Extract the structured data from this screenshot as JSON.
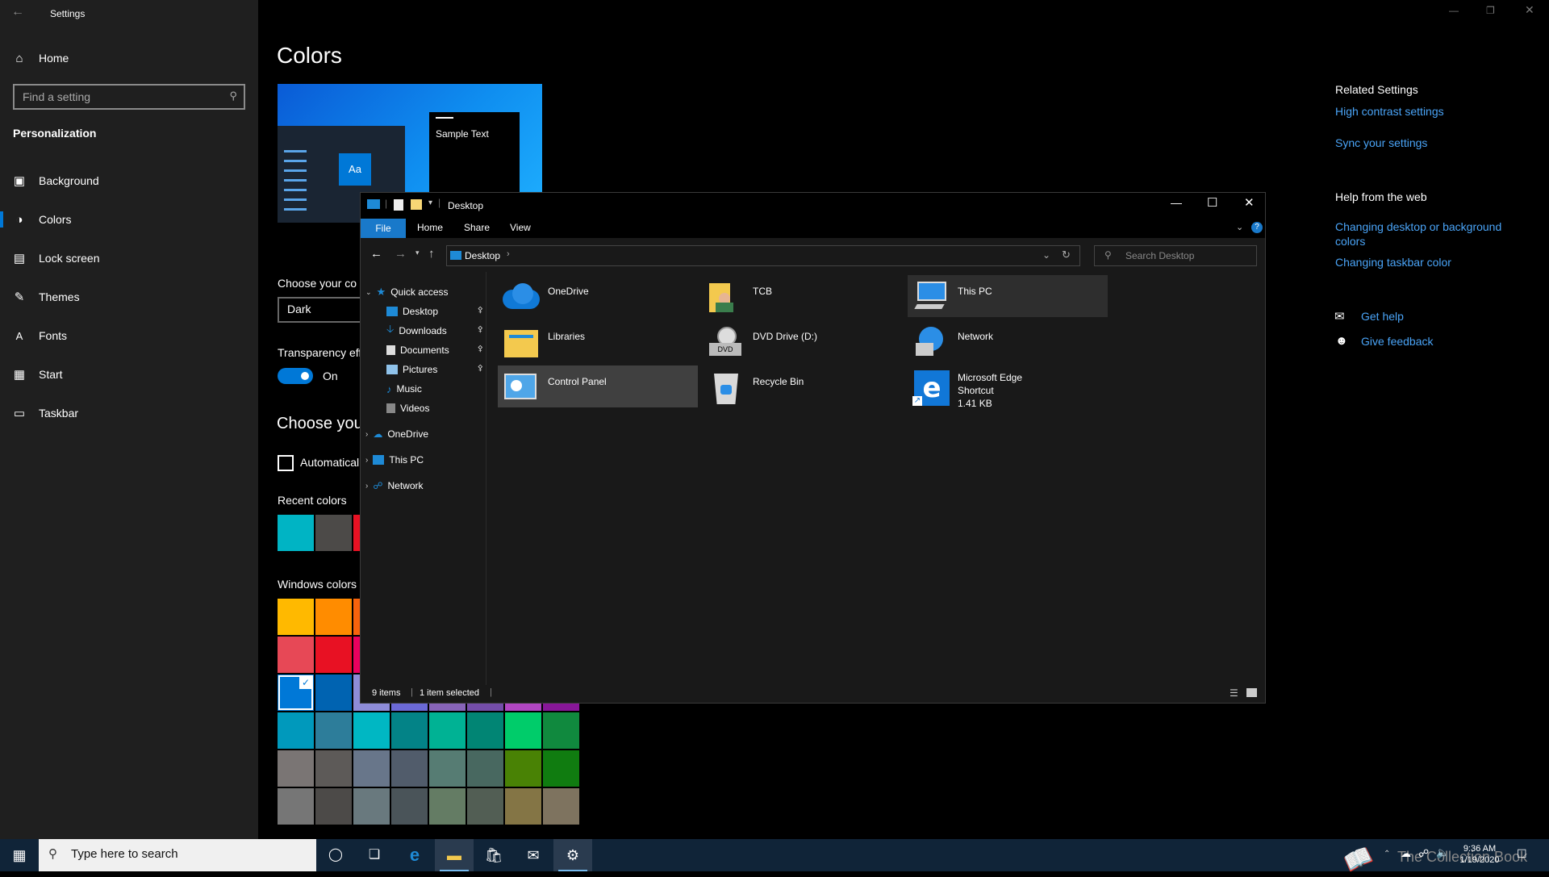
{
  "settings": {
    "title": "Settings",
    "nav": {
      "home": "Home",
      "search_placeholder": "Find a setting",
      "section": "Personalization",
      "items": [
        {
          "label": "Background",
          "icon": "picture-icon"
        },
        {
          "label": "Colors",
          "icon": "palette-icon",
          "selected": true
        },
        {
          "label": "Lock screen",
          "icon": "lock-screen-icon"
        },
        {
          "label": "Themes",
          "icon": "brush-icon"
        },
        {
          "label": "Fonts",
          "icon": "font-icon"
        },
        {
          "label": "Start",
          "icon": "start-icon"
        },
        {
          "label": "Taskbar",
          "icon": "taskbar-icon"
        }
      ]
    },
    "main": {
      "title": "Colors",
      "preview_sample_text": "Sample Text",
      "preview_tile_label": "Aa",
      "choose_color_label": "Choose your co",
      "choose_color_value": "Dark",
      "transparency_label": "Transparency eff",
      "transparency_state": "On",
      "choose_accent_heading": "Choose you",
      "automatic_label": "Automatical",
      "recent_colors_label": "Recent colors",
      "windows_colors_label": "Windows colors",
      "recent_colors": [
        "#00b4c4",
        "#4c4a48",
        "#e81123"
      ],
      "windows_colors": [
        [
          "#ffb900",
          "#ff8c00",
          "#f7630c",
          "#ca5010",
          "#da3b01",
          "#ef6950",
          "#d13438",
          "#ff4343"
        ],
        [
          "#e74856",
          "#e81123",
          "#ea005e",
          "#c30052",
          "#e3008c",
          "#bf0077",
          "#c239b3",
          "#9a0089"
        ],
        [
          "#0078d7",
          "#0063b1",
          "#8e8cd8",
          "#6b69d6",
          "#8764b8",
          "#744da9",
          "#b146c2",
          "#881798"
        ],
        [
          "#0099bc",
          "#2d7d9a",
          "#00b7c3",
          "#038387",
          "#00b294",
          "#018574",
          "#00cc6a",
          "#10893e"
        ],
        [
          "#7a7574",
          "#5d5a58",
          "#68768a",
          "#515c6b",
          "#567c73",
          "#486860",
          "#498205",
          "#107c10"
        ],
        [
          "#767676",
          "#4c4a48",
          "#69797e",
          "#4a5459",
          "#647c64",
          "#525e54",
          "#847545",
          "#7e735f"
        ]
      ]
    },
    "related": {
      "heading": "Related Settings",
      "links": [
        "High contrast settings",
        "Sync your settings"
      ],
      "help_heading": "Help from the web",
      "help_links": [
        "Changing desktop or background colors",
        "Changing taskbar color"
      ],
      "get_help": "Get help",
      "give_feedback": "Give feedback"
    }
  },
  "explorer": {
    "title": "Desktop",
    "ribbon_tabs": [
      "File",
      "Home",
      "Share",
      "View"
    ],
    "address": "Desktop",
    "search_placeholder": "Search Desktop",
    "nav_tree": {
      "quick_access": "Quick access",
      "quick_items": [
        "Desktop",
        "Downloads",
        "Documents",
        "Pictures",
        "Music",
        "Videos"
      ],
      "roots": [
        "OneDrive",
        "This PC",
        "Network"
      ]
    },
    "items": [
      {
        "name": "OneDrive",
        "icon": "onedrive-icon"
      },
      {
        "name": "TCB",
        "icon": "user-folder-icon"
      },
      {
        "name": "This PC",
        "icon": "computer-icon"
      },
      {
        "name": "Libraries",
        "icon": "libraries-icon"
      },
      {
        "name": "DVD Drive (D:)",
        "icon": "dvd-drive-icon"
      },
      {
        "name": "Network",
        "icon": "network-icon"
      },
      {
        "name": "Control Panel",
        "icon": "control-panel-icon"
      },
      {
        "name": "Recycle Bin",
        "icon": "recycle-bin-icon"
      },
      {
        "name": "Microsoft Edge",
        "sub1": "Shortcut",
        "sub2": "1.41 KB",
        "icon": "edge-icon"
      }
    ],
    "status_count": "9 items",
    "status_selected": "1 item selected"
  },
  "taskbar": {
    "search_placeholder": "Type here to search",
    "time": "9:36 AM",
    "date": "1/19/2020",
    "watermark": "The Collection Book"
  }
}
